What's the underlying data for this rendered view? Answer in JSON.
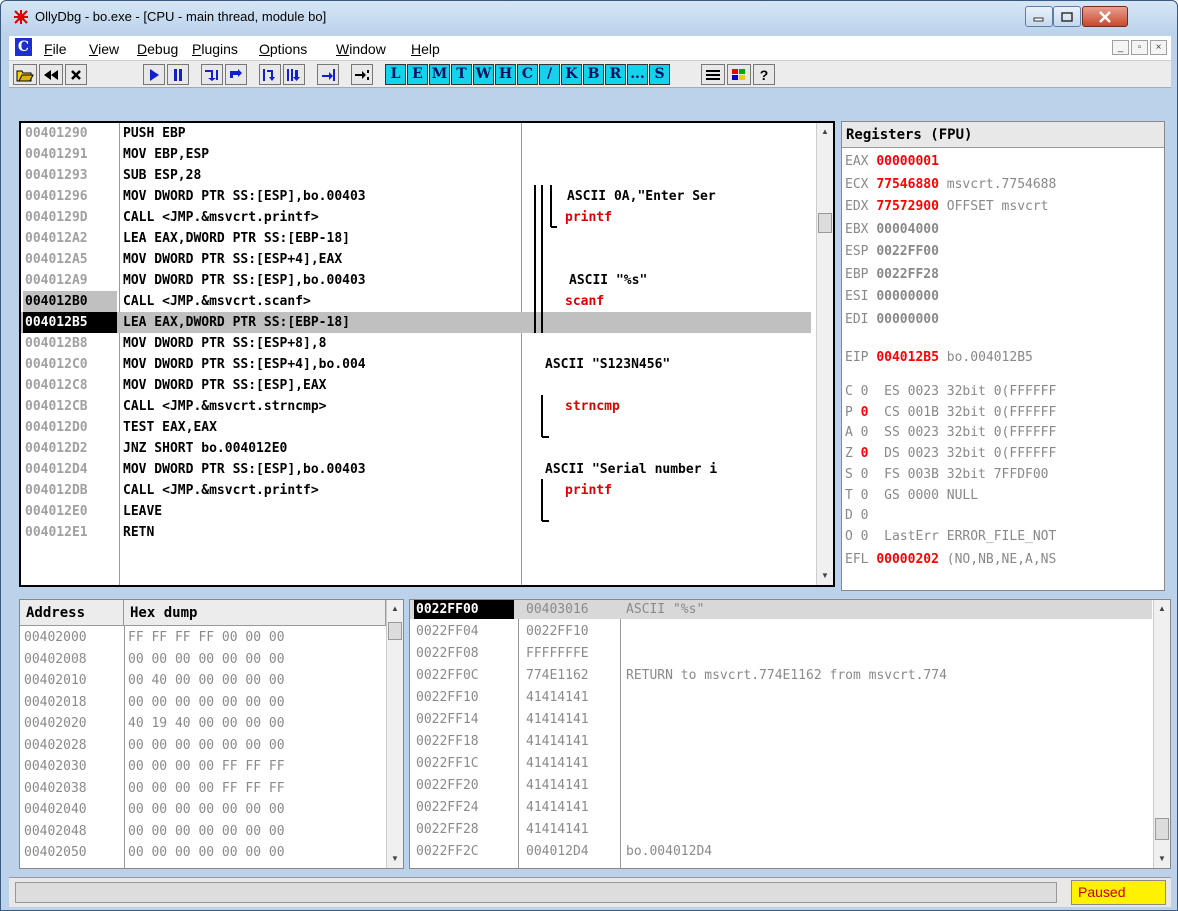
{
  "window": {
    "title": "OllyDbg - bo.exe - [CPU - main thread, module bo]"
  },
  "menu": {
    "items": [
      "File",
      "View",
      "Debug",
      "Plugins",
      "Options",
      "Window",
      "Help"
    ]
  },
  "toolbar": {
    "letters": [
      "L",
      "E",
      "M",
      "T",
      "W",
      "H",
      "C",
      "/",
      "K",
      "B",
      "R",
      "...",
      "S"
    ]
  },
  "cpu": {
    "rows": [
      {
        "addr": "00401290",
        "ins": "PUSH EBP",
        "comment": "",
        "addr_style": "normal"
      },
      {
        "addr": "00401291",
        "ins": "MOV EBP,ESP",
        "comment": "",
        "addr_style": "normal"
      },
      {
        "addr": "00401293",
        "ins": "SUB ESP,28",
        "comment": "",
        "addr_style": "normal"
      },
      {
        "addr": "00401296",
        "ins": "MOV DWORD PTR SS:[ESP],bo.00403",
        "comment": "ASCII 0A,\"Enter Ser",
        "addr_style": "normal"
      },
      {
        "addr": "0040129D",
        "ins": "CALL <JMP.&msvcrt.printf>",
        "comment": "printf",
        "addr_style": "normal"
      },
      {
        "addr": "004012A2",
        "ins": "LEA EAX,DWORD PTR SS:[EBP-18]",
        "comment": "",
        "addr_style": "normal"
      },
      {
        "addr": "004012A5",
        "ins": "MOV DWORD PTR SS:[ESP+4],EAX",
        "comment": "",
        "addr_style": "normal"
      },
      {
        "addr": "004012A9",
        "ins": "MOV DWORD PTR SS:[ESP],bo.00403",
        "comment": "ASCII \"%s\"",
        "addr_style": "normal"
      },
      {
        "addr": "004012B0",
        "ins": "CALL <JMP.&msvcrt.scanf>",
        "comment": "scanf",
        "addr_style": "selected"
      },
      {
        "addr": "004012B5",
        "ins": "LEA EAX,DWORD PTR SS:[EBP-18]",
        "comment": "",
        "addr_style": "eip"
      },
      {
        "addr": "004012B8",
        "ins": "MOV DWORD PTR SS:[ESP+8],8",
        "comment": "",
        "addr_style": "normal"
      },
      {
        "addr": "004012C0",
        "ins": "MOV DWORD PTR SS:[ESP+4],bo.004",
        "comment": "ASCII \"S123N456\"",
        "addr_style": "normal"
      },
      {
        "addr": "004012C8",
        "ins": "MOV DWORD PTR SS:[ESP],EAX",
        "comment": "",
        "addr_style": "normal"
      },
      {
        "addr": "004012CB",
        "ins": "CALL <JMP.&msvcrt.strncmp>",
        "comment": "strncmp",
        "addr_style": "normal"
      },
      {
        "addr": "004012D0",
        "ins": "TEST EAX,EAX",
        "comment": "",
        "addr_style": "normal"
      },
      {
        "addr": "004012D2",
        "ins": "JNZ SHORT bo.004012E0",
        "comment": "",
        "addr_style": "normal"
      },
      {
        "addr": "004012D4",
        "ins": "MOV DWORD PTR SS:[ESP],bo.00403",
        "comment": "ASCII \"Serial number i",
        "addr_style": "normal"
      },
      {
        "addr": "004012DB",
        "ins": "CALL <JMP.&msvcrt.printf>",
        "comment": "printf",
        "addr_style": "normal"
      },
      {
        "addr": "004012E0",
        "ins": "LEAVE",
        "comment": "",
        "addr_style": "normal"
      },
      {
        "addr": "004012E1",
        "ins": "RETN",
        "comment": "",
        "addr_style": "normal"
      }
    ]
  },
  "registers": {
    "header": "Registers (FPU)",
    "rows": [
      {
        "name": "EAX",
        "value": "00000001",
        "note": "",
        "changed": true
      },
      {
        "name": "ECX",
        "value": "77546880",
        "note": "msvcrt.7754688",
        "changed": true
      },
      {
        "name": "EDX",
        "value": "77572900",
        "note": "OFFSET msvcrt",
        "changed": true
      },
      {
        "name": "EBX",
        "value": "00004000",
        "note": "",
        "changed": false
      },
      {
        "name": "ESP",
        "value": "0022FF00",
        "note": "",
        "changed": false
      },
      {
        "name": "EBP",
        "value": "0022FF28",
        "note": "",
        "changed": false
      },
      {
        "name": "ESI",
        "value": "00000000",
        "note": "",
        "changed": false
      },
      {
        "name": "EDI",
        "value": "00000000",
        "note": "",
        "changed": false
      }
    ],
    "eip": {
      "name": "EIP",
      "value": "004012B5",
      "note": "bo.004012B5"
    },
    "flags": [
      {
        "flag": "C",
        "bit": "0",
        "changed": false,
        "seg": "ES 0023 32bit 0(FFFFFF"
      },
      {
        "flag": "P",
        "bit": "0",
        "changed": true,
        "seg": "CS 001B 32bit 0(FFFFFF"
      },
      {
        "flag": "A",
        "bit": "0",
        "changed": false,
        "seg": "SS 0023 32bit 0(FFFFFF"
      },
      {
        "flag": "Z",
        "bit": "0",
        "changed": true,
        "seg": "DS 0023 32bit 0(FFFFFF"
      },
      {
        "flag": "S",
        "bit": "0",
        "changed": false,
        "seg": "FS 003B 32bit 7FFDF00"
      },
      {
        "flag": "T",
        "bit": "0",
        "changed": false,
        "seg": "GS 0000 NULL"
      },
      {
        "flag": "D",
        "bit": "0",
        "changed": false,
        "seg": ""
      },
      {
        "flag": "O",
        "bit": "0",
        "changed": false,
        "seg": "LastErr ERROR_FILE_NOT"
      }
    ],
    "efl": {
      "name": "EFL",
      "value": "00000202",
      "note": "(NO,NB,NE,A,NS"
    }
  },
  "hexdump": {
    "col_address": "Address",
    "col_hex": "Hex dump",
    "rows": [
      {
        "addr": "00402000",
        "bytes": "FF FF FF FF 00 00 00"
      },
      {
        "addr": "00402008",
        "bytes": "00 00 00 00 00 00 00"
      },
      {
        "addr": "00402010",
        "bytes": "00 40 00 00 00 00 00"
      },
      {
        "addr": "00402018",
        "bytes": "00 00 00 00 00 00 00"
      },
      {
        "addr": "00402020",
        "bytes": "40 19 40 00 00 00 00"
      },
      {
        "addr": "00402028",
        "bytes": "00 00 00 00 00 00 00"
      },
      {
        "addr": "00402030",
        "bytes": "00 00 00 00 FF FF FF"
      },
      {
        "addr": "00402038",
        "bytes": "00 00 00 00 FF FF FF"
      },
      {
        "addr": "00402040",
        "bytes": "00 00 00 00 00 00 00"
      },
      {
        "addr": "00402048",
        "bytes": "00 00 00 00 00 00 00"
      },
      {
        "addr": "00402050",
        "bytes": "00 00 00 00 00 00 00"
      }
    ]
  },
  "stack": {
    "rows": [
      {
        "addr": "0022FF00",
        "value": "00403016",
        "comment": "ASCII \"%s\"",
        "current": true
      },
      {
        "addr": "0022FF04",
        "value": "0022FF10",
        "comment": "",
        "current": false
      },
      {
        "addr": "0022FF08",
        "value": "FFFFFFFE",
        "comment": "",
        "current": false
      },
      {
        "addr": "0022FF0C",
        "value": "774E1162",
        "comment": "RETURN to msvcrt.774E1162 from msvcrt.774",
        "current": false
      },
      {
        "addr": "0022FF10",
        "value": "41414141",
        "comment": "",
        "current": false
      },
      {
        "addr": "0022FF14",
        "value": "41414141",
        "comment": "",
        "current": false
      },
      {
        "addr": "0022FF18",
        "value": "41414141",
        "comment": "",
        "current": false
      },
      {
        "addr": "0022FF1C",
        "value": "41414141",
        "comment": "",
        "current": false
      },
      {
        "addr": "0022FF20",
        "value": "41414141",
        "comment": "",
        "current": false
      },
      {
        "addr": "0022FF24",
        "value": "41414141",
        "comment": "",
        "current": false
      },
      {
        "addr": "0022FF28",
        "value": "41414141",
        "comment": "",
        "current": false
      },
      {
        "addr": "0022FF2C",
        "value": "004012D4",
        "comment": "bo.004012D4",
        "current": false
      }
    ]
  },
  "status": {
    "state": "Paused"
  },
  "colors": {
    "accent_red": "#ff0000",
    "comment_red": "#e00000",
    "tool_cyan": "#15d2ec",
    "status_yellow": "#fff200"
  }
}
